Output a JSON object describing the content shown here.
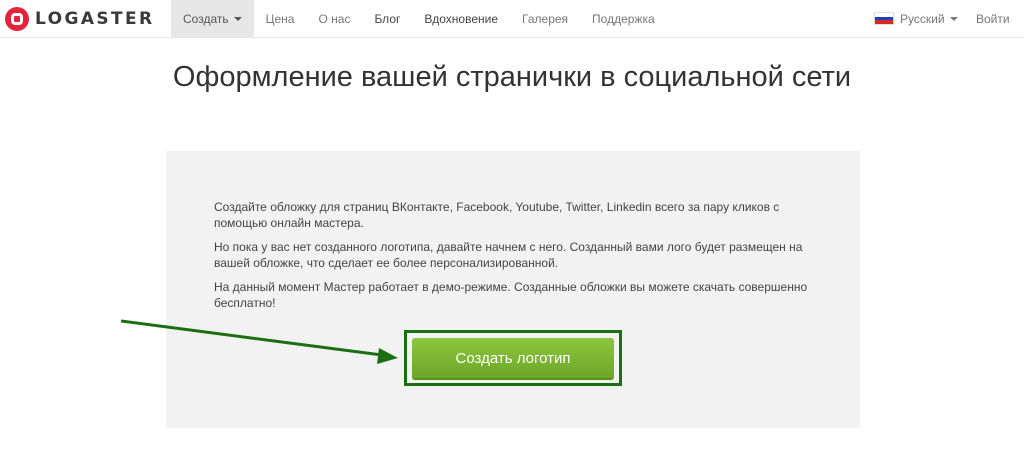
{
  "brand": {
    "name": "LOGASTER"
  },
  "nav": {
    "items": [
      {
        "label": "Создать"
      },
      {
        "label": "Цена"
      },
      {
        "label": "О нас"
      },
      {
        "label": "Блог"
      },
      {
        "label": "Вдохновение"
      },
      {
        "label": "Галерея"
      },
      {
        "label": "Поддержка"
      }
    ],
    "language": "Русский",
    "login": "Войти"
  },
  "page": {
    "title": "Оформление вашей странички в социальной сети",
    "paragraphs": [
      "Создайте обложку для страниц ВКонтакте, Facebook, Youtube, Twitter, Linkedin всего за пару кликов с помощью онлайн мастера.",
      "Но пока у вас нет созданного логотипа, давайте начнем с него. Созданный вами лого будет размещен на вашей обложке, что сделает ее более персонализированной.",
      "На данный момент Мастер работает в демо-режиме. Созданные обложки вы можете скачать совершенно бесплатно!"
    ],
    "button": "Создать логотип"
  },
  "colors": {
    "brand_red": "#e5233c",
    "button_green": "#7cb733",
    "highlight_frame": "#1b6e12",
    "panel_bg": "#f2f2f2"
  },
  "icons": {
    "logo": "logaster-logo-icon",
    "flag": "russia-flag-icon",
    "caret": "caret-down-icon",
    "arrow": "annotation-arrow-icon"
  }
}
